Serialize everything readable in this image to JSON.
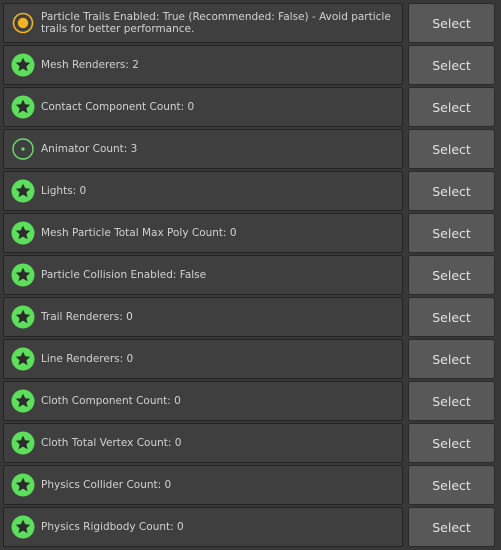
{
  "items": [
    {
      "icon": "warning-icon",
      "text": "Particle Trails Enabled: True (Recommended: False) - Avoid particle trails for better performance.",
      "button": "Select"
    },
    {
      "icon": "star-icon",
      "text": "Mesh Renderers: 2",
      "button": "Select"
    },
    {
      "icon": "star-icon",
      "text": "Contact Component Count: 0",
      "button": "Select"
    },
    {
      "icon": "dot-ring-icon",
      "text": "Animator Count: 3",
      "button": "Select"
    },
    {
      "icon": "star-icon",
      "text": "Lights: 0",
      "button": "Select"
    },
    {
      "icon": "star-icon",
      "text": "Mesh Particle Total Max Poly Count: 0",
      "button": "Select"
    },
    {
      "icon": "star-icon",
      "text": "Particle Collision Enabled: False",
      "button": "Select"
    },
    {
      "icon": "star-icon",
      "text": "Trail Renderers: 0",
      "button": "Select"
    },
    {
      "icon": "star-icon",
      "text": "Line Renderers: 0",
      "button": "Select"
    },
    {
      "icon": "star-icon",
      "text": "Cloth Component Count: 0",
      "button": "Select"
    },
    {
      "icon": "star-icon",
      "text": "Cloth Total Vertex Count: 0",
      "button": "Select"
    },
    {
      "icon": "star-icon",
      "text": "Physics Collider Count: 0",
      "button": "Select"
    },
    {
      "icon": "star-icon",
      "text": "Physics Rigidbody Count: 0",
      "button": "Select"
    }
  ],
  "colors": {
    "excellent": "#5ce05c",
    "good": "#6ee06e",
    "warning": "#f2b422"
  }
}
